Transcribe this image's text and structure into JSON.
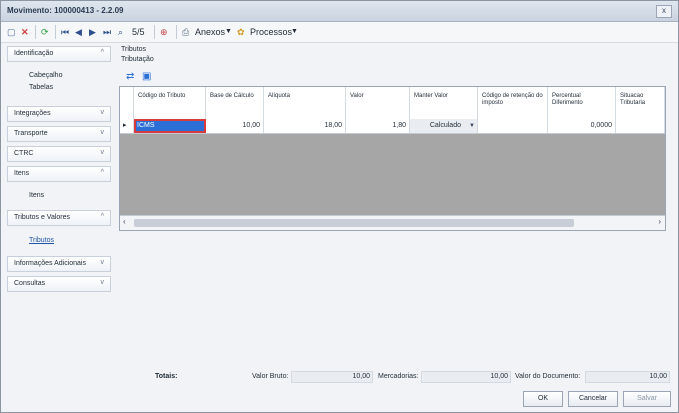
{
  "window": {
    "title": "Movimento: 100000413 - 2.2.09",
    "close_label": "x"
  },
  "toolbar": {
    "nav_record": "5/5",
    "anexos_label": "Anexos",
    "processos_label": "Processos"
  },
  "sidebar": {
    "sections": [
      {
        "label": "Identificação",
        "chevron": "^",
        "items": [
          "Cabeçalho",
          "Tabelas"
        ]
      },
      {
        "label": "Integrações",
        "chevron": "v",
        "items": []
      },
      {
        "label": "Transporte",
        "chevron": "v",
        "items": []
      },
      {
        "label": "CTRC",
        "chevron": "v",
        "items": []
      },
      {
        "label": "Itens",
        "chevron": "^",
        "items": [
          "Itens"
        ]
      },
      {
        "label": "Tributos e Valores",
        "chevron": "^",
        "items": [
          "Tributos"
        ]
      },
      {
        "label": "Informações Adicionais",
        "chevron": "v",
        "items": []
      },
      {
        "label": "Consultas",
        "chevron": "v",
        "items": []
      }
    ]
  },
  "main": {
    "group_title": "Tributos",
    "subgroup_title": "Tributação",
    "grid": {
      "columns": [
        "Código do Tributo",
        "Base de Cálculo",
        "Alíquota",
        "Valor",
        "Manter Valor",
        "Código de retenção do imposto",
        "Percentual Diferimento",
        "Situacao Tributaria"
      ],
      "rows": [
        {
          "codigo": "ICMS",
          "base": "10,00",
          "aliquota": "18,00",
          "valor": "1,80",
          "manter": "Calculado",
          "retencao": "",
          "percentual": "0,0000",
          "situacao": ""
        }
      ]
    }
  },
  "footer": {
    "totais_label": "Totais:",
    "valor_bruto_label": "Valor Bruto:",
    "valor_bruto_value": "10,00",
    "mercadorias_label": "Mercadorias:",
    "mercadorias_value": "10,00",
    "valor_documento_label": "Valor do Documento:",
    "valor_documento_value": "10,00",
    "ok_label": "OK",
    "cancelar_label": "Cancelar",
    "salvar_label": "Salvar"
  },
  "colors": {
    "accent": "#2b6fd6",
    "selected_cell_border": "#d83b3b"
  }
}
